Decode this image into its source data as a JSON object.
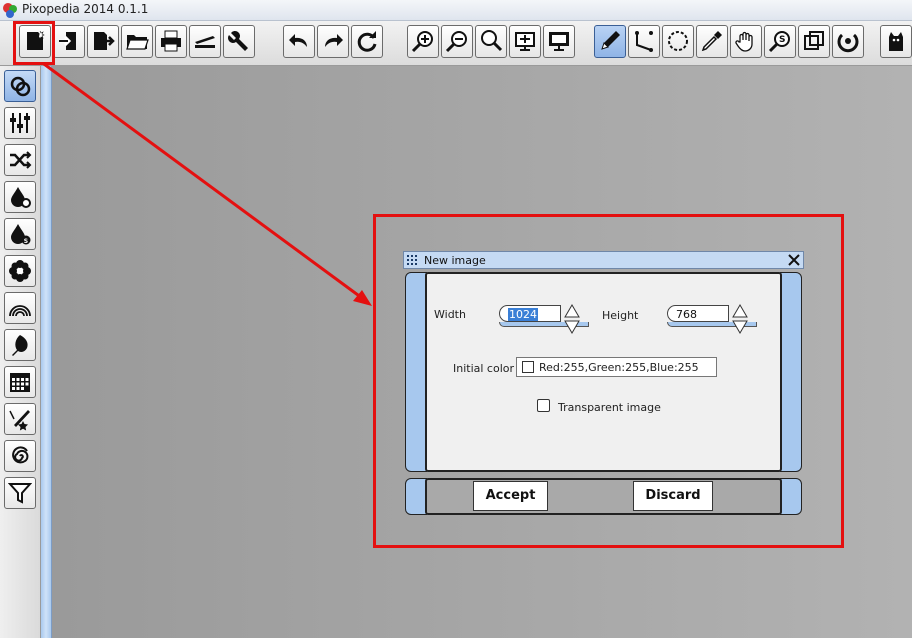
{
  "app": {
    "title": "Pixopedia 2014 0.1.1"
  },
  "toolbar": {
    "icons": [
      "new-image-icon",
      "import-icon",
      "export-icon",
      "open-folder-icon",
      "print-icon",
      "stapler-icon",
      "wrench-icon",
      "undo-icon",
      "redo-icon",
      "refresh-icon",
      "zoom-in-icon",
      "zoom-out-icon",
      "zoom-icon",
      "fit-window-icon",
      "fullscreen-icon",
      "pencil-icon",
      "path-icon",
      "ellipse-select-icon",
      "eyedropper-icon",
      "hand-icon",
      "zoom-s-icon",
      "crop-icon",
      "rotate-icon",
      "cat-icon"
    ]
  },
  "dialog": {
    "title": "New image",
    "width_label": "Width",
    "width_value": "1024",
    "height_label": "Height",
    "height_value": "768",
    "color_label": "Initial color",
    "color_value": "Red:255,Green:255,Blue:255",
    "transparent_label": "Transparent image",
    "accept_label": "Accept",
    "discard_label": "Discard"
  },
  "colors": {
    "accent": "#a7c8ee",
    "annotation": "#e41010"
  }
}
